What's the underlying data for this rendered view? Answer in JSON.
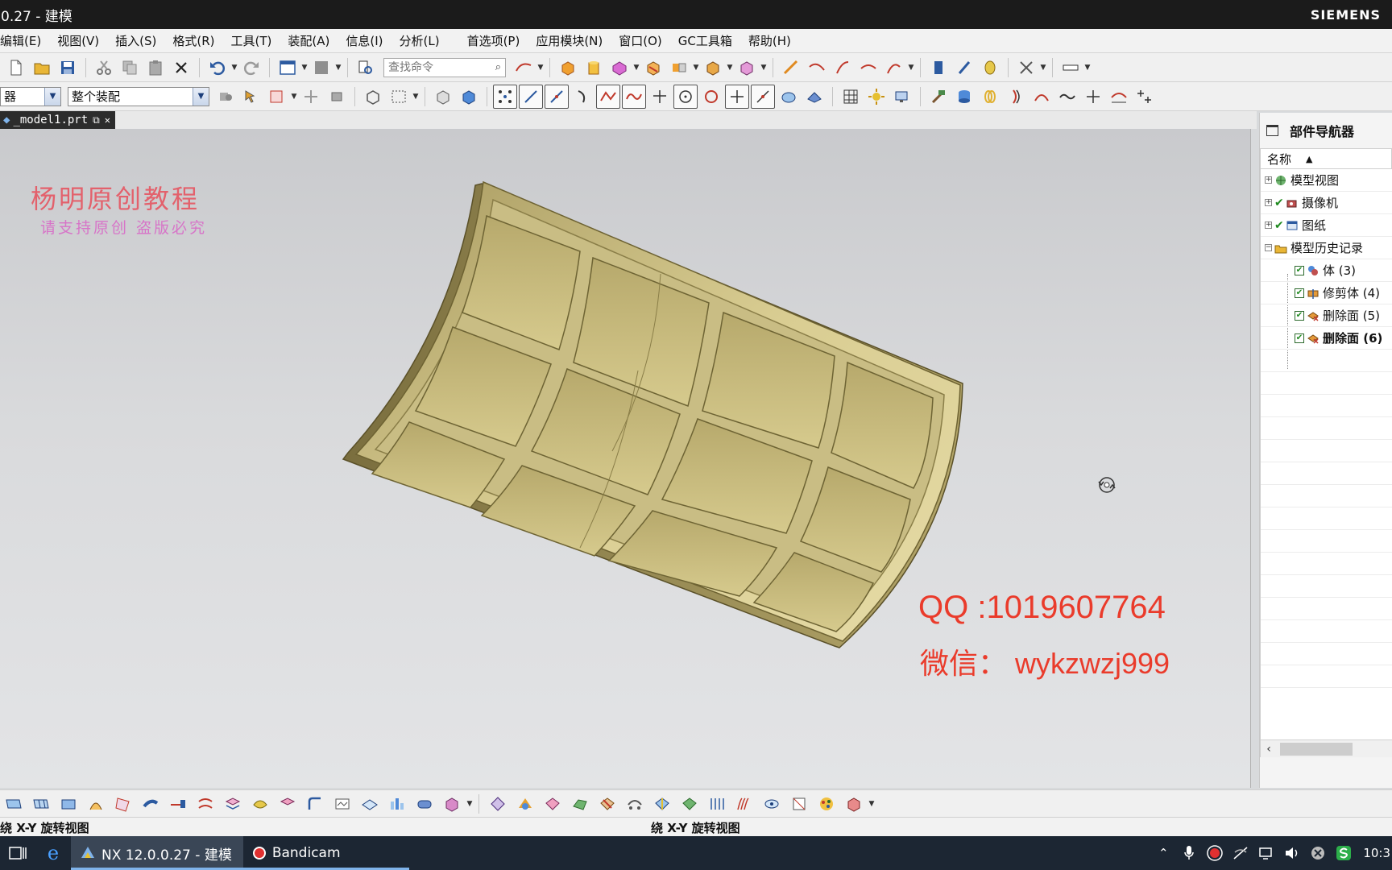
{
  "window": {
    "title": "0.27 - 建模",
    "brand": "SIEMENS"
  },
  "menu": [
    {
      "label": "编辑(E)"
    },
    {
      "label": "视图(V)"
    },
    {
      "label": "插入(S)"
    },
    {
      "label": "格式(R)"
    },
    {
      "label": "工具(T)"
    },
    {
      "label": "装配(A)"
    },
    {
      "label": "信息(I)"
    },
    {
      "label": "分析(L)"
    },
    {
      "label": "首选项(P)"
    },
    {
      "label": "应用模块(N)"
    },
    {
      "label": "窗口(O)"
    },
    {
      "label": "GC工具箱"
    },
    {
      "label": "帮助(H)"
    }
  ],
  "toolbar": {
    "search_placeholder": "查找命令"
  },
  "selection_bar": {
    "filter_value": "器",
    "scope_value": "整个装配"
  },
  "document_tab": {
    "label": "_model1.prt"
  },
  "watermark": {
    "title": "杨明原创教程",
    "subtitle": "请支持原创 盗版必究",
    "qq": "QQ :1019607764",
    "wechat": "微信： wykzwzj999"
  },
  "navigator": {
    "title": "部件导航器",
    "column_name": "名称",
    "items": [
      {
        "label": "模型视图",
        "expander": "+",
        "check": "",
        "icon": "model-views-icon"
      },
      {
        "label": "摄像机",
        "expander": "+",
        "check": "✔",
        "icon": "camera-icon"
      },
      {
        "label": "图纸",
        "expander": "+",
        "check": "✔",
        "icon": "drawing-icon"
      },
      {
        "label": "模型历史记录",
        "expander": "−",
        "check": "",
        "icon": "folder-icon"
      },
      {
        "label": "体 (3)",
        "check": "✔",
        "icon": "body-icon"
      },
      {
        "label": "修剪体 (4)",
        "check": "✔",
        "icon": "trim-body-icon"
      },
      {
        "label": "删除面 (5)",
        "check": "✔",
        "icon": "delete-face-icon"
      },
      {
        "label": "删除面 (6)",
        "check": "✔",
        "icon": "delete-face-icon",
        "bold": true
      }
    ]
  },
  "status": {
    "left": "绕 X-Y 旋转视图",
    "right": "绕 X-Y 旋转视图"
  },
  "taskbar": {
    "apps": [
      {
        "label": "NX 12.0.0.27 - 建模"
      },
      {
        "label": "Bandicam"
      }
    ],
    "clock": "10:3"
  },
  "colors": {
    "model_fill": "#c9bd84",
    "watermark_red": "#ea3b2b",
    "taskbar": "#1c2633"
  }
}
